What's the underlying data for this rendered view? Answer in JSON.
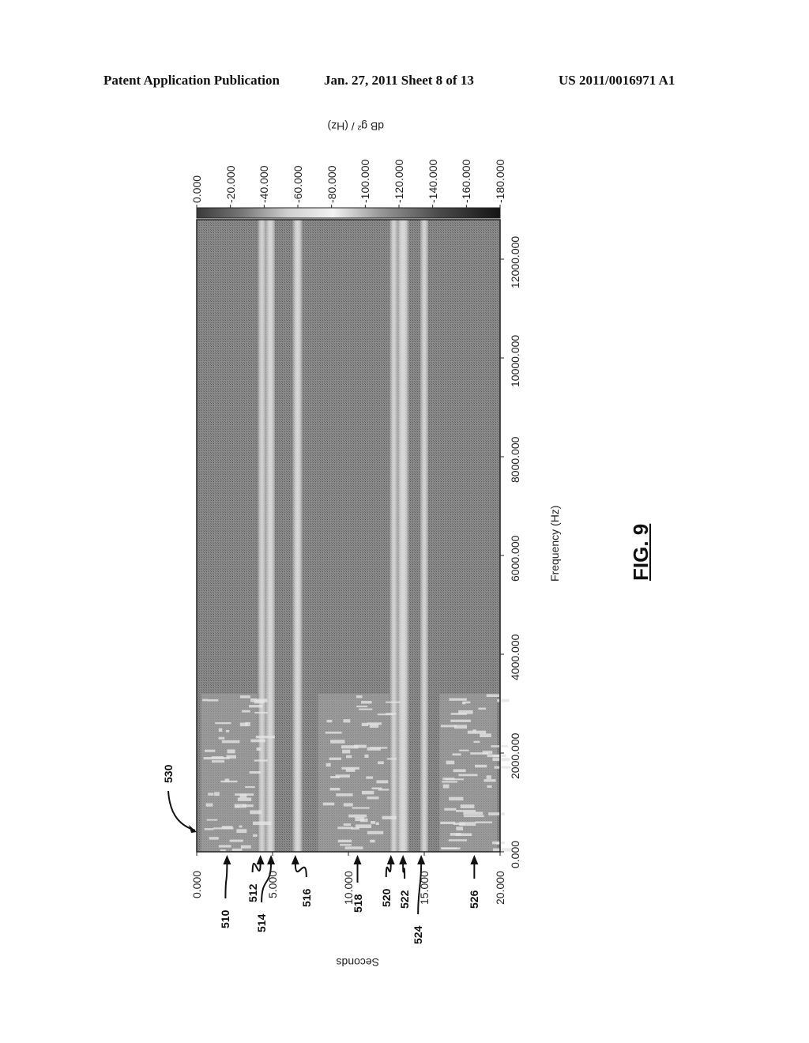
{
  "header": {
    "publication": "Patent Application Publication",
    "date_sheet": "Jan. 27, 2011  Sheet 8 of 13",
    "patent_number": "US 2011/0016971 A1"
  },
  "figure_label": "FIG. 9",
  "chart_data": {
    "type": "heatmap",
    "title": "",
    "xlabel": "Frequency (Hz)",
    "ylabel": "Seconds",
    "colorbar_label": "dB g² / (Hz)",
    "x_range": [
      0,
      12800
    ],
    "y_range": [
      0,
      20
    ],
    "colorbar_range": [
      0,
      -180
    ],
    "x_ticks": [
      "0.000",
      "2000.000",
      "4000.000",
      "6000.000",
      "8000.000",
      "10000.000",
      "12000.000"
    ],
    "x_tick_values": [
      0,
      2000,
      4000,
      6000,
      8000,
      10000,
      12000
    ],
    "y_ticks": [
      "0.000",
      "5.000",
      "10.000",
      "15.000",
      "20.000"
    ],
    "y_tick_values": [
      0,
      5,
      10,
      15,
      20
    ],
    "colorbar_ticks": [
      "0.000",
      "-20.000",
      "-40.000",
      "-60.000",
      "-80.000",
      "-100.000",
      "-120.000",
      "-140.000",
      "-160.000",
      "-180.000"
    ],
    "colorbar_tick_values": [
      0,
      -20,
      -40,
      -60,
      -80,
      -100,
      -120,
      -140,
      -160,
      -180
    ],
    "bright_bands_seconds": [
      {
        "start": 4.1,
        "end": 4.5,
        "note": "512"
      },
      {
        "start": 4.6,
        "end": 5.1,
        "note": "514"
      },
      {
        "start": 6.4,
        "end": 6.9,
        "note": "516"
      },
      {
        "start": 12.8,
        "end": 13.2,
        "note": "520"
      },
      {
        "start": 13.3,
        "end": 13.9,
        "note": "522"
      },
      {
        "start": 14.8,
        "end": 15.2,
        "note": "524"
      }
    ],
    "speech_regions_seconds": [
      {
        "start": 0.3,
        "end": 4.0,
        "max_freq_hz": 3200
      },
      {
        "start": 8.0,
        "end": 12.7,
        "max_freq_hz": 3200
      },
      {
        "start": 16.0,
        "end": 19.8,
        "max_freq_hz": 3200
      }
    ]
  },
  "reference_labels": [
    {
      "id": "510",
      "seconds": 2.0
    },
    {
      "id": "512",
      "seconds": 4.2
    },
    {
      "id": "514",
      "seconds": 4.9
    },
    {
      "id": "516",
      "seconds": 6.5
    },
    {
      "id": "518",
      "seconds": 10.6
    },
    {
      "id": "520",
      "seconds": 12.8
    },
    {
      "id": "522",
      "seconds": 13.6
    },
    {
      "id": "524",
      "seconds": 14.8
    },
    {
      "id": "526",
      "seconds": 18.3
    },
    {
      "id": "530",
      "seconds": 0.0,
      "freq_hz": 400
    }
  ]
}
